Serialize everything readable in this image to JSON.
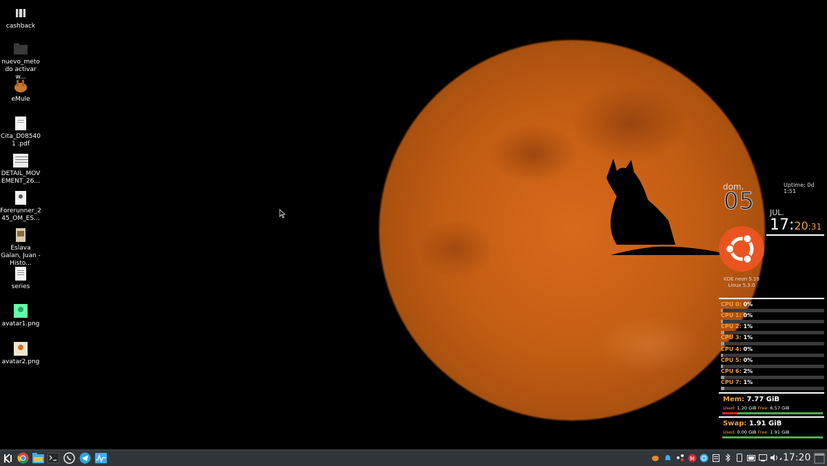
{
  "desktop": {
    "icons": [
      {
        "label": "cashback",
        "icon": "folder-dark-icon"
      },
      {
        "label": "nuevo_metodo activar w...",
        "icon": "folder-dark-icon"
      },
      {
        "label": "eMule",
        "icon": "emule-icon"
      },
      {
        "label": "Cita_D085401 .pdf",
        "icon": "pdf-document-icon"
      },
      {
        "label": "DETAIL_MOV EMENT_26...",
        "icon": "image-thumbnail-icon"
      },
      {
        "label": "Forerunner_2 45_OM_ES...",
        "icon": "document-icon"
      },
      {
        "label": "Eslava Galan, Juan - Histo...",
        "icon": "book-cover-icon"
      },
      {
        "label": "series",
        "icon": "text-file-icon"
      },
      {
        "label": "avatar1.png",
        "icon": "image-icon"
      },
      {
        "label": "avatar2.png",
        "icon": "image-icon"
      }
    ]
  },
  "widgets": {
    "uptime": "Uptime: 0d 1:51",
    "date": {
      "weekday": "dom.",
      "day": "05",
      "month": "JUL."
    },
    "clock": {
      "hours": "17:",
      "minutes": "20",
      "seconds": ":31"
    },
    "distro": {
      "line1": "KDE neon 5.19",
      "line2": "Linux 5.3.0"
    },
    "cpus": [
      {
        "label": "CPU 0:",
        "value": "0%",
        "load": 0.02
      },
      {
        "label": "CPU 1:",
        "value": "0%",
        "load": 0.02
      },
      {
        "label": "CPU 2:",
        "value": "1%",
        "load": 0.03
      },
      {
        "label": "CPU 3:",
        "value": "1%",
        "load": 0.03
      },
      {
        "label": "CPU 4:",
        "value": "0%",
        "load": 0.02
      },
      {
        "label": "CPU 5:",
        "value": "0%",
        "load": 0.02
      },
      {
        "label": "CPU 6:",
        "value": "2%",
        "load": 0.03
      },
      {
        "label": "CPU 7:",
        "value": "1%",
        "load": 0.03
      }
    ],
    "mem": {
      "title": "Mem:",
      "total": "7.77 GiB",
      "used_label": "Used:",
      "used": "1.20 GiB",
      "free_label": "Free:",
      "free": "6.57 GiB",
      "used_fraction": 0.15
    },
    "swap": {
      "title": "Swap:",
      "total": "1.91 GiB",
      "used_label": "Used:",
      "used": "0.00 GiB",
      "free_label": "Free:",
      "free": "1.91 GiB",
      "used_fraction": 0.0
    }
  },
  "taskbar": {
    "launchers": [
      "kde-menu-icon",
      "chrome-icon",
      "file-manager-icon",
      "terminal-icon",
      "whatsapp-icon",
      "telegram-icon",
      "system-monitor-icon"
    ],
    "tray": [
      "emule-tray-icon",
      "notification-bell-icon",
      "network-share-icon",
      "mega-icon",
      "ubuntu-updates-icon",
      "clipboard-icon",
      "bluetooth-icon",
      "battery-icon",
      "phone-connect-icon",
      "screen-icon",
      "volume-icon",
      "expand-tray-icon"
    ],
    "clock": "17:20"
  },
  "colors": {
    "accent": "#f0a040",
    "panel": "#31363b",
    "moon": "#c45d14"
  }
}
